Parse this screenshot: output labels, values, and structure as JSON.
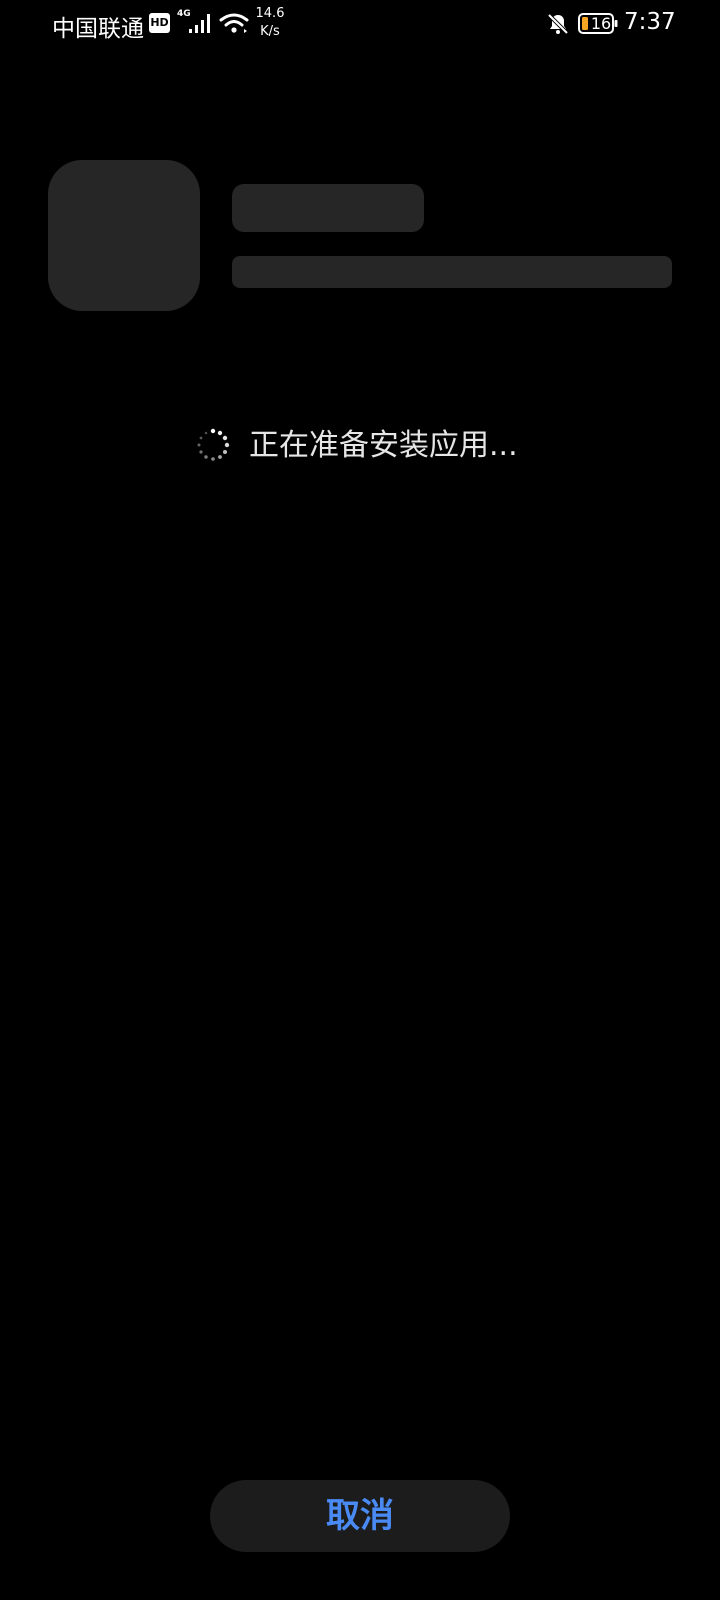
{
  "status_bar": {
    "carrier": "中国联通",
    "hd_badge": "HD",
    "network_type": "4G",
    "speed_value": "14.6",
    "speed_unit": "K/s",
    "battery_level": "16",
    "time": "7:37",
    "icons": [
      "hd-icon",
      "signal-icon",
      "wifi-icon",
      "mute-bell-icon",
      "battery-icon"
    ],
    "battery_color": "#f5a623"
  },
  "install": {
    "status_text": "正在准备安装应用..."
  },
  "actions": {
    "cancel_label": "取消"
  },
  "colors": {
    "background": "#000000",
    "placeholder": "#262626",
    "button_bg": "#1c1c1c",
    "accent": "#4a8af4"
  }
}
